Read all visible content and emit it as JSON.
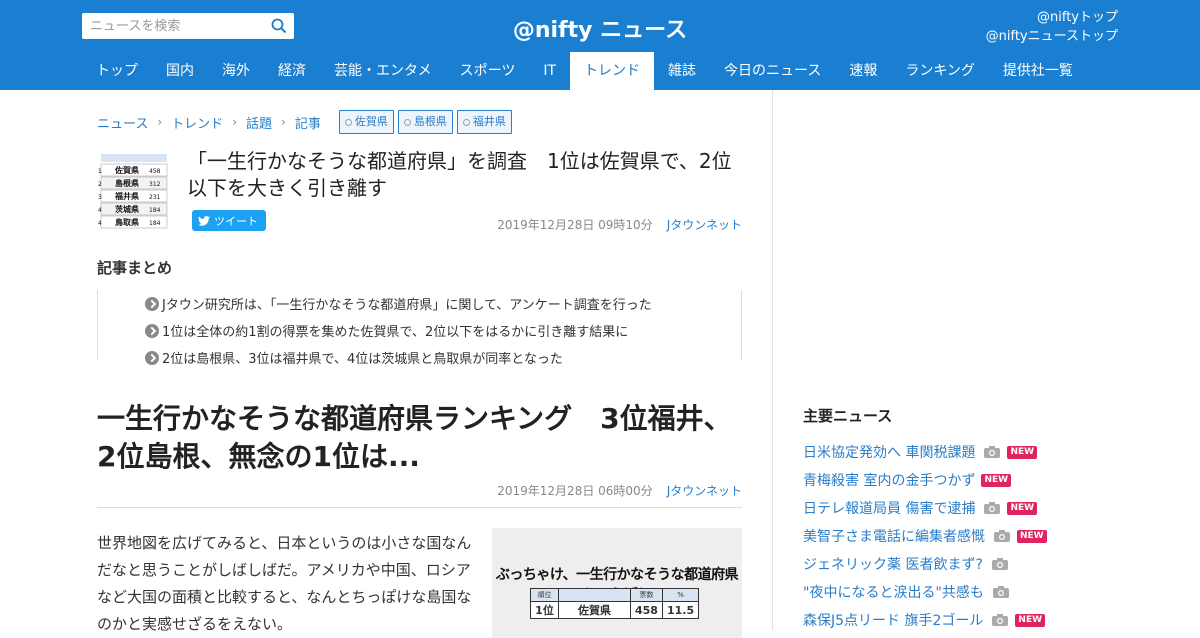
{
  "header": {
    "search_placeholder": "ニュースを検索",
    "logo": "@nifty ニュース",
    "top_links": [
      "@niftyトップ",
      "@niftyニューストップ"
    ],
    "nav": [
      {
        "label": "トップ",
        "active": false
      },
      {
        "label": "国内",
        "active": false
      },
      {
        "label": "海外",
        "active": false
      },
      {
        "label": "経済",
        "active": false
      },
      {
        "label": "芸能・エンタメ",
        "active": false
      },
      {
        "label": "スポーツ",
        "active": false
      },
      {
        "label": "IT",
        "active": false
      },
      {
        "label": "トレンド",
        "active": true
      },
      {
        "label": "雑誌",
        "active": false
      },
      {
        "label": "今日のニュース",
        "active": false
      },
      {
        "label": "速報",
        "active": false
      },
      {
        "label": "ランキング",
        "active": false
      },
      {
        "label": "提供社一覧",
        "active": false
      }
    ],
    "brand_color": "#1a7fd0"
  },
  "breadcrumb": [
    "ニュース",
    "トレンド",
    "話題",
    "記事"
  ],
  "tags": [
    "佐賀県",
    "島根県",
    "福井県"
  ],
  "headline": {
    "title": "「一生行かなそうな都道府県」を調査　1位は佐賀県で、2位以下を大きく引き離す",
    "tweet_label": "ツイート",
    "date": "2019年12月28日 09時10分",
    "source": "Jタウンネット"
  },
  "thumb_rows": [
    {
      "rank": "1",
      "pref": "佐賀県",
      "votes": "458"
    },
    {
      "rank": "2",
      "pref": "島根県",
      "votes": "312"
    },
    {
      "rank": "3",
      "pref": "福井県",
      "votes": "231"
    },
    {
      "rank": "4",
      "pref": "茨城県",
      "votes": "184"
    },
    {
      "rank": "4",
      "pref": "鳥取県",
      "votes": "184"
    }
  ],
  "summary": {
    "heading": "記事まとめ",
    "items": [
      "Jタウン研究所は、「一生行かなそうな都道府県」に関して、アンケート調査を行った",
      "1位は全体の約1割の得票を集めた佐賀県で、2位以下をはるかに引き離す結果に",
      "2位は島根県、3位は福井県で、4位は茨城県と鳥取県が同率となった"
    ]
  },
  "article": {
    "title": "一生行かなそうな都道府県ランキング　3位福井、2位島根、無念の1位は...",
    "date": "2019年12月28日 06時00分",
    "source": "Jタウンネット",
    "body": "世界地図を広げてみると、日本というのは小さな国なんだなと思うことがしばしばだ。アメリカや中国、ロシアなど大国の面積と比較すると、なんとちっぽけな島国なのかと実感せざるをえない。",
    "figure": {
      "title": "ぶっちゃけ、一生行かなそうな都道府県といえば？",
      "headers": [
        "順位",
        "",
        "票数",
        "%"
      ],
      "row": [
        "1位",
        "佐賀県",
        "458",
        "11.5"
      ]
    }
  },
  "sidebar": {
    "heading": "主要ニュース",
    "items": [
      {
        "label": "日米協定発効へ 車関税課題",
        "camera": true,
        "new": true
      },
      {
        "label": "青梅殺害 室内の金手つかず",
        "camera": false,
        "new": true
      },
      {
        "label": "日テレ報道局員 傷害で逮捕",
        "camera": true,
        "new": true
      },
      {
        "label": "美智子さま電話に編集者感慨",
        "camera": true,
        "new": true
      },
      {
        "label": "ジェネリック薬 医者飲まず?",
        "camera": true,
        "new": false
      },
      {
        "label": "\"夜中になると涙出る\"共感も",
        "camera": true,
        "new": false
      },
      {
        "label": "森保J5点リード 旗手2ゴール",
        "camera": true,
        "new": true
      }
    ],
    "new_label": "NEW"
  }
}
